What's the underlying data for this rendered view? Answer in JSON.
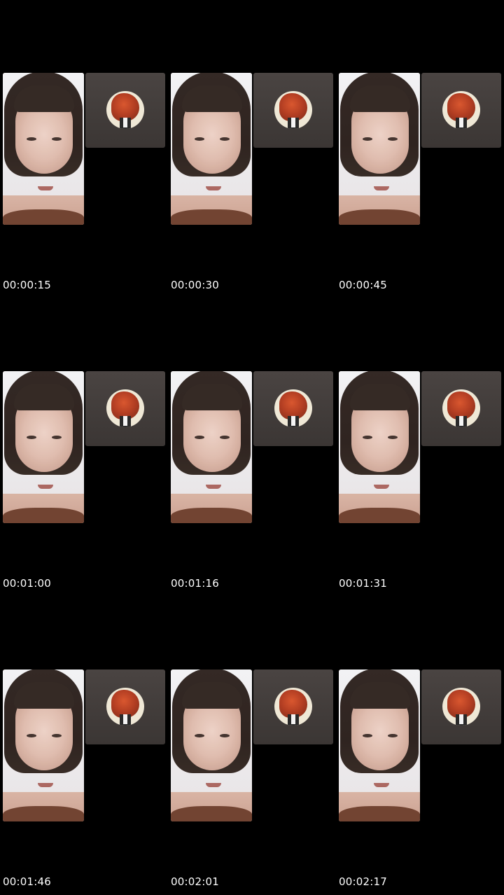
{
  "thumbnails": [
    {
      "timestamp": "00:00:15"
    },
    {
      "timestamp": "00:00:30"
    },
    {
      "timestamp": "00:00:45"
    },
    {
      "timestamp": "00:01:00"
    },
    {
      "timestamp": "00:01:16"
    },
    {
      "timestamp": "00:01:31"
    },
    {
      "timestamp": "00:01:46"
    },
    {
      "timestamp": "00:02:01"
    },
    {
      "timestamp": "00:02:17"
    }
  ],
  "colors": {
    "background": "#000000",
    "pip_background": "#433d3b",
    "timestamp_text": "#ffffff"
  },
  "icons": {
    "caller_avatar": "caller-avatar-icon"
  }
}
